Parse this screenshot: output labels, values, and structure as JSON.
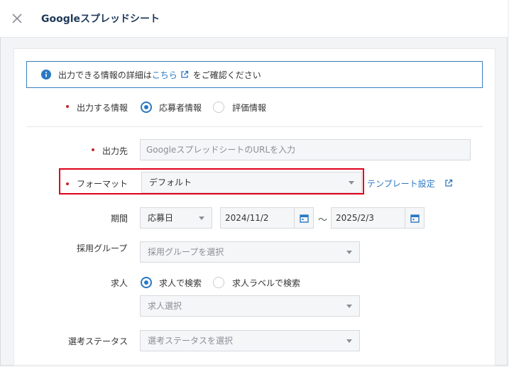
{
  "header": {
    "title": "Googleスプレッドシート"
  },
  "notice": {
    "prefix": "出力できる情報の詳細は",
    "link": "こちら",
    "suffix": "をご確認ください"
  },
  "fields": {
    "output_info": {
      "label": "出力する情報",
      "options": [
        {
          "label": "応募者情報",
          "checked": true
        },
        {
          "label": "評価情報",
          "checked": false
        }
      ]
    },
    "destination": {
      "label": "出力先",
      "placeholder": "GoogleスプレッドシートのURLを入力"
    },
    "format": {
      "label": "フォーマット",
      "value": "デフォルト",
      "template_link": "テンプレート設定"
    },
    "period": {
      "label": "期間",
      "type_value": "応募日",
      "from": "2024/11/2",
      "separator": "〜",
      "to": "2025/2/3"
    },
    "recruit_group": {
      "label": "採用グループ",
      "placeholder": "採用グループを選択"
    },
    "job": {
      "label": "求人",
      "options": [
        {
          "label": "求人で検索",
          "checked": true
        },
        {
          "label": "求人ラベルで検索",
          "checked": false
        }
      ],
      "select_placeholder": "求人選択"
    },
    "status": {
      "label": "選考ステータス",
      "placeholder": "選考ステータスを選択"
    }
  },
  "colors": {
    "accent": "#2a78c3",
    "required": "#c2272d",
    "highlight": "#e0001a",
    "title": "#1f3a5a"
  }
}
